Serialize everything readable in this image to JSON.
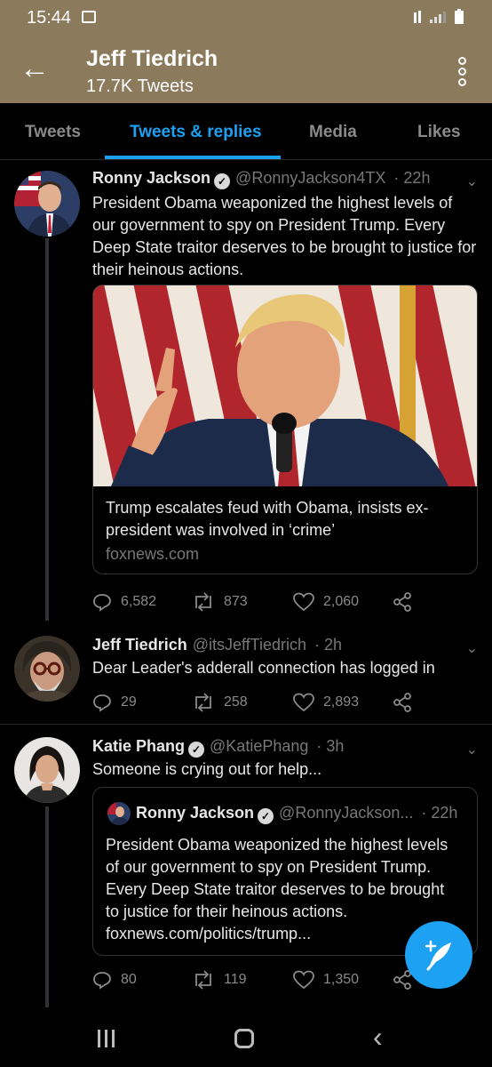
{
  "status_bar": {
    "time": "15:44"
  },
  "header": {
    "back_glyph": "←",
    "name": "Jeff Tiedrich",
    "tweet_count": "17.7K Tweets"
  },
  "tabs": [
    {
      "label": "Tweets"
    },
    {
      "label": "Tweets & replies"
    },
    {
      "label": "Media"
    },
    {
      "label": "Likes"
    }
  ],
  "tweets": [
    {
      "name": "Ronny Jackson",
      "handle": "@RonnyJackson4TX",
      "time": "· 22h",
      "text": "President Obama weaponized the highest levels of our government to spy on President Trump. Every Deep State traitor deserves to be brought to justice for their heinous actions.",
      "card": {
        "title": "Trump escalates feud with Obama, insists ex-president was involved in ‘crime’",
        "domain": "foxnews.com"
      },
      "replies": "6,582",
      "retweets": "873",
      "likes": "2,060"
    },
    {
      "name": "Jeff Tiedrich",
      "handle": "@itsJeffTiedrich",
      "time": "· 2h",
      "text": "Dear Leader's adderall connection has logged in",
      "replies": "29",
      "retweets": "258",
      "likes": "2,893"
    },
    {
      "name": "Katie Phang",
      "handle": "@KatiePhang",
      "time": "· 3h",
      "text": "Someone is crying out for help...",
      "quote": {
        "name": "Ronny Jackson",
        "handle": "@RonnyJackson...",
        "time": "· 22h",
        "text": "President Obama weaponized the highest levels of our government to spy on President Trump. Every Deep State traitor deserves to be brought to justice for their heinous actions. foxnews.com/politics/trump..."
      },
      "replies": "80",
      "retweets": "119",
      "likes": "1,350"
    }
  ],
  "colors": {
    "accent": "#1da1f2",
    "header_bg": "#8b7a5c",
    "background": "#000000"
  },
  "icons": {
    "reply": "reply-icon",
    "retweet": "retweet-icon",
    "like": "heart-icon",
    "share": "share-icon",
    "compose": "compose-tweet-icon"
  }
}
